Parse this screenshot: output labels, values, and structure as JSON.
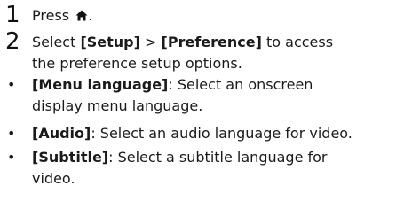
{
  "steps": [
    {
      "number": "1",
      "prefix": "Press ",
      "icon": "home-icon",
      "suffix": "."
    },
    {
      "number": "2",
      "prefix": "Select ",
      "setup": "[Setup]",
      "sep": " > ",
      "preference": "[Preference]",
      "line1_tail": " to access",
      "line2": "the preference setup options."
    }
  ],
  "bullets": [
    {
      "symbol": "•",
      "term": "[Menu language]",
      "line1_rest": ": Select an onscreen",
      "line2": "display menu language."
    },
    {
      "symbol": "•",
      "term": "[Audio]",
      "line1_rest": ": Select an audio language for video.",
      "line2": ""
    },
    {
      "symbol": "•",
      "term": "[Subtitle]",
      "line1_rest": ": Select a subtitle language for",
      "line2": "video."
    }
  ]
}
